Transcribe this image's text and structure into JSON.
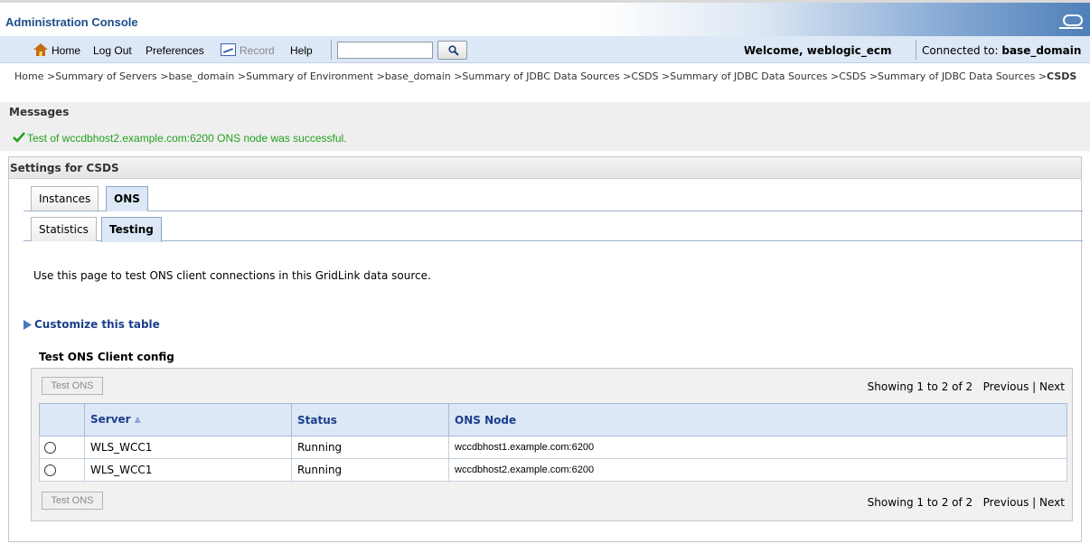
{
  "header": {
    "app_title": "Administration Console"
  },
  "toolbar": {
    "home": "Home",
    "logout": "Log Out",
    "preferences": "Preferences",
    "record": "Record",
    "help": "Help",
    "search_value": "",
    "welcome": "Welcome, weblogic_ecm",
    "connected_label": "Connected to:",
    "connected_domain": "base_domain"
  },
  "breadcrumb": {
    "path": "Home >Summary of Servers >base_domain >Summary of Environment >base_domain >Summary of JDBC Data Sources >CSDS >Summary of JDBC Data Sources >CSDS >Summary of JDBC Data Sources >",
    "current": "CSDS"
  },
  "messages": {
    "title": "Messages",
    "success": "Test of wccdbhost2.example.com:6200 ONS node was successful."
  },
  "settings": {
    "title": "Settings for CSDS",
    "tabs": [
      {
        "label": "Instances"
      },
      {
        "label": "ONS",
        "active": true
      }
    ],
    "subtabs": [
      {
        "label": "Statistics"
      },
      {
        "label": "Testing",
        "active": true
      }
    ],
    "intro": "Use this page to test ONS client connections in this GridLink data source.",
    "customize_link": "Customize this table",
    "table_title": "Test ONS Client config"
  },
  "table": {
    "button_label": "Test ONS",
    "showing": "Showing 1 to 2 of 2",
    "previous": "Previous",
    "next": "Next",
    "columns": [
      "Server",
      "Status",
      "ONS Node"
    ],
    "sort_indicator": "⩓",
    "rows": [
      {
        "server": "WLS_WCC1",
        "status": "Running",
        "ons_node": "wccdbhost1.example.com:6200"
      },
      {
        "server": "WLS_WCC1",
        "status": "Running",
        "ons_node": "wccdbhost2.example.com:6200"
      }
    ]
  },
  "colors": {
    "accent": "#1c4d8c",
    "toolbar": "#dde8f6",
    "success": "#22a11f"
  }
}
